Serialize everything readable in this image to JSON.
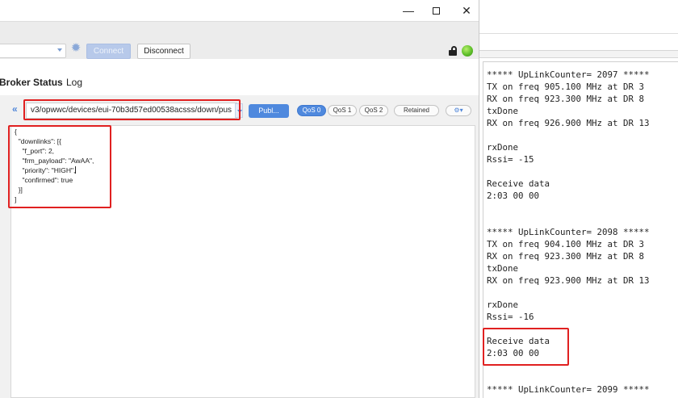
{
  "window": {
    "minimize_glyph": "—",
    "close_glyph": "✕"
  },
  "toolbar": {
    "connect_label": "Connect",
    "disconnect_label": "Disconnect",
    "gear_glyph": "✹"
  },
  "tabs": [
    {
      "label": "Broker Status"
    },
    {
      "label": "Log"
    }
  ],
  "publish": {
    "chevron_glyph": "«",
    "topic_value": "v3/opwwc/devices/eui-70b3d57ed00538acsss/down/pus",
    "publish_label": "Publ...",
    "qos_options": [
      "QoS 0",
      "QoS 1",
      "QoS 2"
    ],
    "qos_selected": "QoS 0",
    "retained_label": "Retained",
    "options_glyph": "⚙▾",
    "payload_lines": [
      "{",
      "  \"downlinks\": [{",
      "    \"f_port\": 2,",
      "    \"frm_payload\": \"AwAA\",",
      "    \"priority\": \"HIGH\",",
      "    \"confirmed\": true",
      "  }]",
      "]"
    ]
  },
  "console": {
    "lines": [
      "***** UpLinkCounter= 2097 *****",
      "TX on freq 905.100 MHz at DR 3",
      "RX on freq 923.300 MHz at DR 8",
      "txDone",
      "RX on freq 926.900 MHz at DR 13",
      "",
      "rxDone",
      "Rssi= -15",
      "",
      "Receive data",
      "2:03 00 00",
      "",
      "",
      "***** UpLinkCounter= 2098 *****",
      "TX on freq 904.100 MHz at DR 3",
      "RX on freq 923.300 MHz at DR 8",
      "txDone",
      "RX on freq 923.900 MHz at DR 13",
      "",
      "rxDone",
      "Rssi= -16",
      "",
      "Receive data",
      "2:03 00 00",
      "",
      "",
      "***** UpLinkCounter= 2099 *****"
    ]
  }
}
